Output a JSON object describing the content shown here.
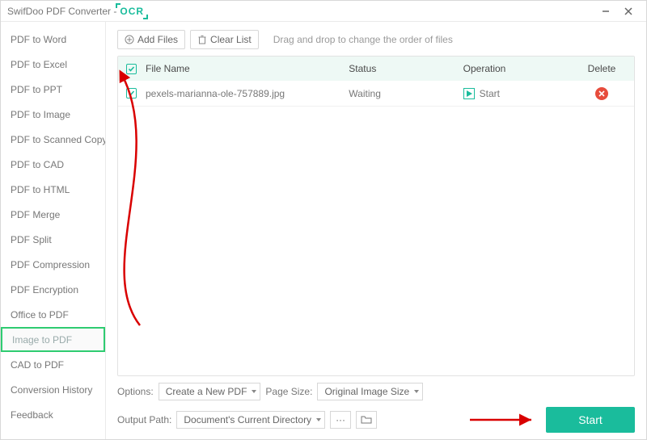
{
  "window": {
    "title": "SwifDoo PDF Converter - ",
    "ocr_label": "OCR"
  },
  "sidebar": {
    "items": [
      "PDF to Word",
      "PDF to Excel",
      "PDF to PPT",
      "PDF to Image",
      "PDF to Scanned Copy",
      "PDF to CAD",
      "PDF to HTML",
      "PDF Merge",
      "PDF Split",
      "PDF Compression",
      "PDF Encryption",
      "Office to PDF",
      "Image to PDF",
      "CAD to PDF",
      "Conversion History",
      "Feedback"
    ],
    "active_index": 12
  },
  "toolbar": {
    "add_files": "Add Files",
    "clear_list": "Clear List",
    "hint": "Drag and drop to change the order of files"
  },
  "table": {
    "headers": {
      "file_name": "File Name",
      "status": "Status",
      "operation": "Operation",
      "delete": "Delete"
    },
    "rows": [
      {
        "checked": true,
        "name": "pexels-marianna-ole-757889.jpg",
        "status": "Waiting",
        "op": "Start"
      }
    ]
  },
  "options": {
    "label": "Options:",
    "create_pdf": "Create a New PDF",
    "page_size_label": "Page Size:",
    "page_size_value": "Original Image Size"
  },
  "output": {
    "label": "Output Path:",
    "value": "Document's Current Directory"
  },
  "start_button": "Start"
}
